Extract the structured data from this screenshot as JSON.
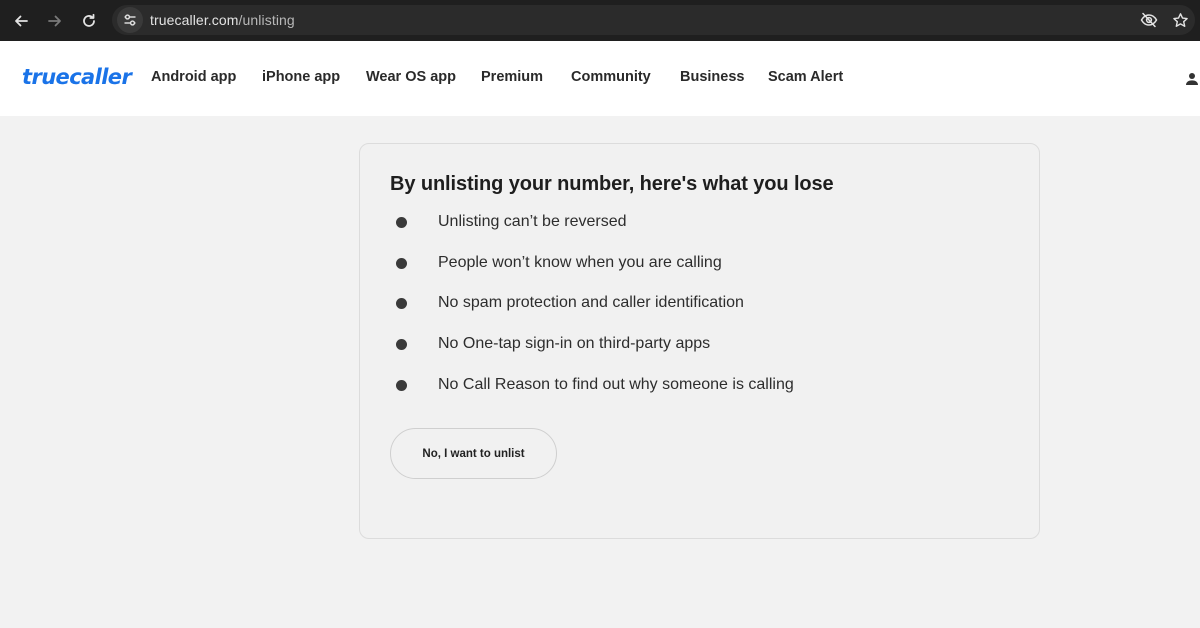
{
  "browser": {
    "url_host": "truecaller.com",
    "url_path": "/unlisting"
  },
  "header": {
    "logo": "truecaller",
    "nav": [
      "Android app",
      "iPhone app",
      "Wear OS app",
      "Premium",
      "Community",
      "Business",
      "Scam Alert"
    ]
  },
  "card": {
    "title": "By unlisting your number, here's what you lose",
    "items": [
      "Unlisting can’t be reversed",
      "People won’t know when you are calling",
      "No spam protection and caller identification",
      "No One-tap sign-in on third-party apps",
      "No Call Reason to find out why someone is calling"
    ],
    "button_label": "No, I want to unlist"
  },
  "colors": {
    "brand": "#1a73e8",
    "page_bg": "#f2f2f2",
    "chrome_bg": "#1f1f1f"
  }
}
